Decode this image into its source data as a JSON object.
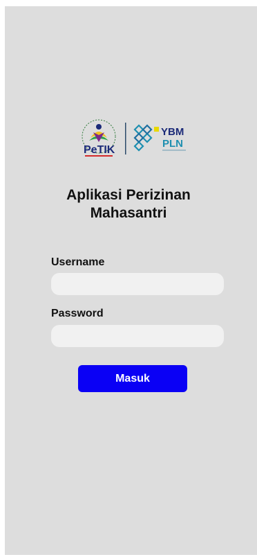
{
  "logos": {
    "left": {
      "name": "PeTIK",
      "text": "PeTIK"
    },
    "right": {
      "name": "YBM PLN",
      "line1": "YBM",
      "line2": "PLN"
    }
  },
  "title": {
    "line1": "Aplikasi Perizinan",
    "line2": "Mahasantri"
  },
  "form": {
    "username_label": "Username",
    "username_value": "",
    "password_label": "Password",
    "password_value": "",
    "submit_label": "Masuk"
  },
  "colors": {
    "screen_bg": "#dddddd",
    "input_bg": "#f1f1f1",
    "button_bg": "#0a00f5",
    "button_text": "#ffffff"
  }
}
